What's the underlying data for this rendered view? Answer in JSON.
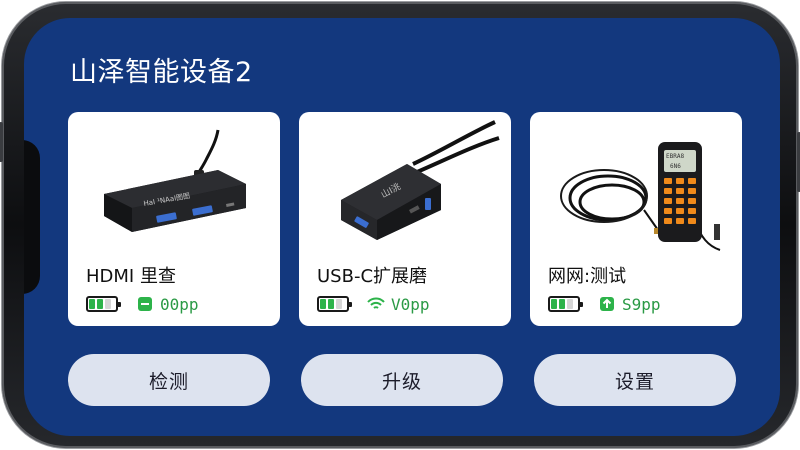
{
  "app": {
    "title": "山泽智能设备2"
  },
  "devices": [
    {
      "name": "HDMI 里查",
      "signal_icon": "minus-square-icon",
      "signal_text": "00pp",
      "battery_level": 0.67,
      "image_label": "HaI ¹NAaI图图"
    },
    {
      "name": "USB-C扩展磨",
      "signal_icon": "wifi-icon",
      "signal_text": "V0pp",
      "battery_level": 0.67,
      "image_label": "山I洮"
    },
    {
      "name": "网网:测试",
      "signal_icon": "plus-square-icon",
      "signal_text": "S9pp",
      "battery_level": 0.67,
      "image_label": "EBRA8\n6N6"
    }
  ],
  "actions": [
    {
      "label": "检测"
    },
    {
      "label": "升级"
    },
    {
      "label": "设置"
    }
  ],
  "colors": {
    "screen_bg": "#13387e",
    "card_bg": "#ffffff",
    "pill_bg": "#dde3ef",
    "status_green": "#2db34a"
  }
}
